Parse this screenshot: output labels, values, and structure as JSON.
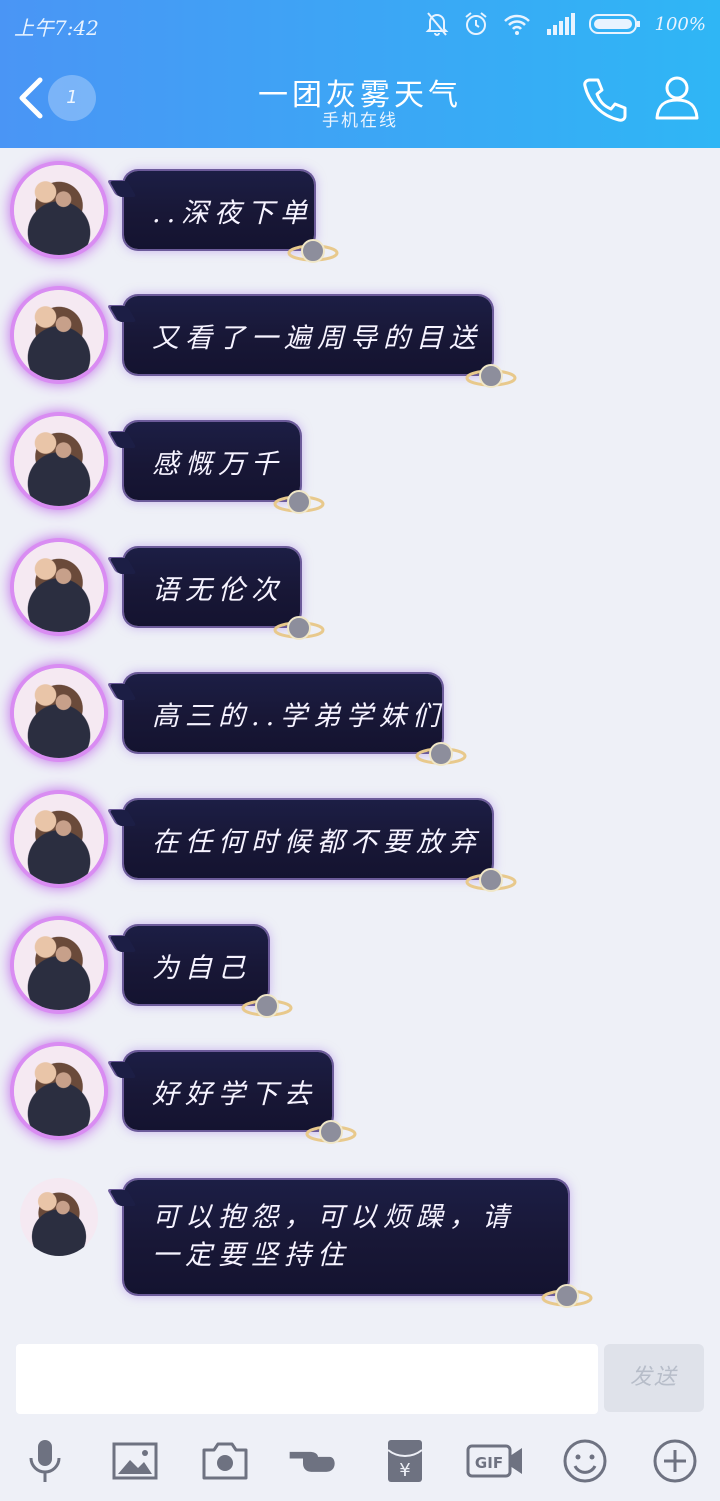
{
  "status": {
    "time": "上午7:42",
    "battery": "100%"
  },
  "header": {
    "unread_count": "1",
    "contact_name": "一团灰雾天气",
    "contact_status": "手机在线"
  },
  "messages": [
    {
      "text": "..深夜下单"
    },
    {
      "text": "又看了一遍周导的目送"
    },
    {
      "text": "感慨万千"
    },
    {
      "text": "语无伦次"
    },
    {
      "text": "高三的..学弟学妹们"
    },
    {
      "text": "在任何时候都不要放弃"
    },
    {
      "text": "为自己"
    },
    {
      "text": "好好学下去"
    },
    {
      "text": "可以抱怨，可以烦躁，请一定要坚持住"
    }
  ],
  "composer": {
    "input_value": "",
    "send_label": "发送"
  },
  "toolbar": [
    "microphone-icon",
    "image-icon",
    "camera-icon",
    "hongbao-hand-icon",
    "red-packet-icon",
    "gif-icon",
    "emoji-icon",
    "plus-icon"
  ],
  "colors": {
    "header_start": "#4a95f5",
    "header_end": "#2fb6f5",
    "bubble": "#1c1e45",
    "glow": "#c06ee8"
  }
}
